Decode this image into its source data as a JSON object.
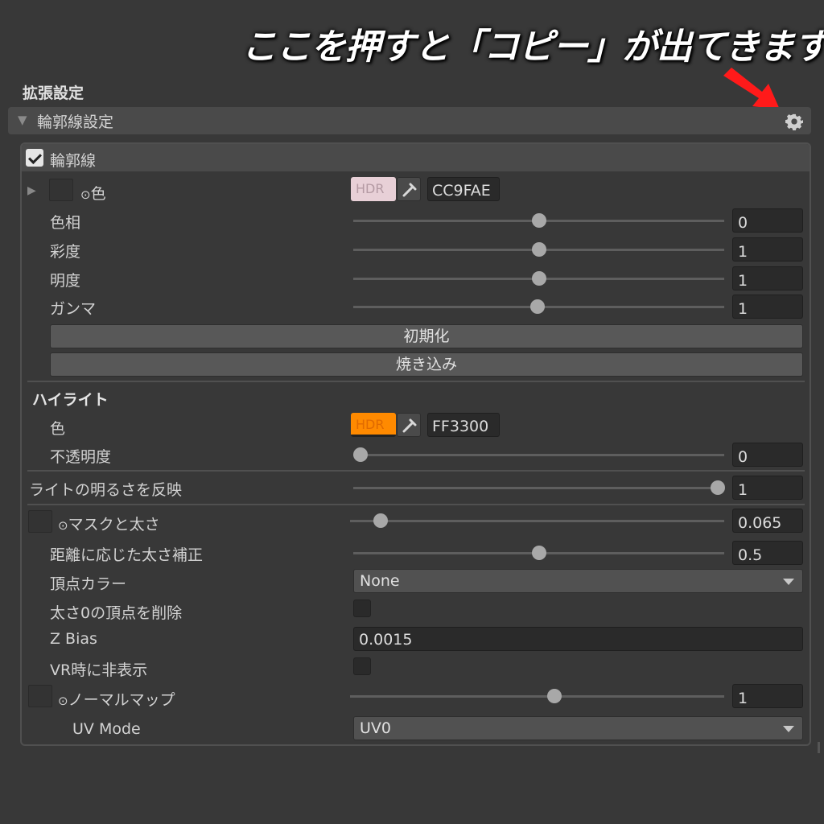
{
  "annotation": "ここを押すと「コピー」が出てきます",
  "section_title": "拡張設定",
  "foldout": {
    "label": "輪郭線設定",
    "icon": "gear-icon"
  },
  "outline": {
    "toggle_label": "輪郭線",
    "toggle_checked": true,
    "color": {
      "label": "色",
      "hdr_label": "HDR",
      "hex": "CC9FAE",
      "swatch_color": "#e8d0d7"
    },
    "hue": {
      "label": "色相",
      "value": "0",
      "fraction": 0.5
    },
    "saturation": {
      "label": "彩度",
      "value": "1",
      "fraction": 0.5
    },
    "brightness": {
      "label": "明度",
      "value": "1",
      "fraction": 0.5
    },
    "gamma": {
      "label": "ガンマ",
      "value": "1",
      "fraction": 0.5
    },
    "reset_button": "初期化",
    "bake_button": "焼き込み"
  },
  "highlight": {
    "heading": "ハイライト",
    "color": {
      "label": "色",
      "hdr_label": "HDR",
      "hex": "FF3300",
      "swatch_color": "#ff8a00"
    },
    "opacity": {
      "label": "不透明度",
      "value": "0",
      "fraction": 0.0
    }
  },
  "light_reflect": {
    "label": "ライトの明るさを反映",
    "value": "1",
    "fraction": 1.0
  },
  "mask_width": {
    "label": "マスクと太さ",
    "value": "0.065",
    "fraction": 0.08
  },
  "distance_correction": {
    "label": "距離に応じた太さ補正",
    "value": "0.5",
    "fraction": 0.5
  },
  "vertex_color": {
    "label": "頂点カラー",
    "selected": "None"
  },
  "remove_zero_width": {
    "label": "太さ0の頂点を削除",
    "checked": false
  },
  "z_bias": {
    "label": "Z Bias",
    "value": "0.0015"
  },
  "hide_in_vr": {
    "label": "VR時に非表示",
    "checked": false
  },
  "normal_map": {
    "label": "ノーマルマップ",
    "value": "1",
    "fraction": 0.55
  },
  "uv_mode": {
    "label": "UV Mode",
    "selected": "UV0"
  },
  "colors": {
    "accent_arrow": "#ff1a1a",
    "panel_bg": "#383838"
  }
}
